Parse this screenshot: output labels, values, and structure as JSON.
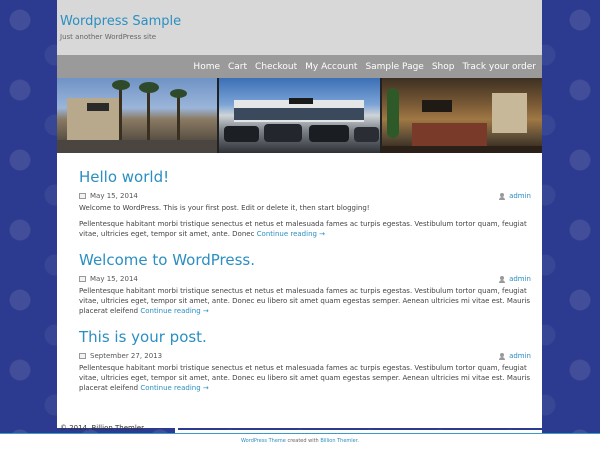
{
  "site": {
    "title": "Wordpress Sample",
    "description": "Just another WordPress site"
  },
  "nav": [
    {
      "label": "Home"
    },
    {
      "label": "Cart"
    },
    {
      "label": "Checkout"
    },
    {
      "label": "My Account"
    },
    {
      "label": "Sample Page"
    },
    {
      "label": "Shop"
    },
    {
      "label": "Track your order"
    }
  ],
  "banner": {
    "images": [
      {
        "icon": "chase-bank-photo",
        "sign": "CHASE"
      },
      {
        "icon": "car-dealership-photo",
        "sign": "TOWBIN"
      },
      {
        "icon": "hotel-lobby-photo",
        "sign": "WYNDHAM"
      }
    ]
  },
  "posts": [
    {
      "title": "Hello world!",
      "date": "May 15, 2014",
      "author": "admin",
      "paragraphs": [
        "Welcome to WordPress. This is your first post. Edit or delete it, then start blogging!",
        "Pellentesque habitant morbi tristique senectus et netus et malesuada fames ac turpis egestas. Vestibulum tortor quam, feugiat vitae, ultricies eget, tempor sit amet, ante. Donec"
      ],
      "more": "Continue reading →"
    },
    {
      "title": "Welcome to WordPress.",
      "date": "May 15, 2014",
      "author": "admin",
      "paragraphs": [
        "Pellentesque habitant morbi tristique senectus et netus et malesuada fames ac turpis egestas. Vestibulum tortor quam, feugiat vitae, ultricies eget, tempor sit amet, ante. Donec eu libero sit amet quam egestas semper. Aenean ultricies mi vitae est. Mauris placerat eleifend"
      ],
      "more": "Continue reading →"
    },
    {
      "title": "This is your post.",
      "date": "September 27, 2013",
      "author": "admin",
      "paragraphs": [
        "Pellentesque habitant morbi tristique senectus et netus et malesuada fames ac turpis egestas. Vestibulum tortor quam, feugiat vitae, ultricies eget, tempor sit amet, ante. Donec eu libero sit amet quam egestas semper. Aenean ultricies mi vitae est. Mauris placerat eleifend"
      ],
      "more": "Continue reading →"
    }
  ],
  "copyright": "© 2014, Billion Themler",
  "footer": {
    "link1": "WordPress Theme",
    "mid": " created with ",
    "link2": "Billion Themler",
    "end": "."
  },
  "colors": {
    "background": "#2c3a8f",
    "accent": "#2b8fc2",
    "nav": "#9a9a9a",
    "header": "#d8d8d8"
  }
}
